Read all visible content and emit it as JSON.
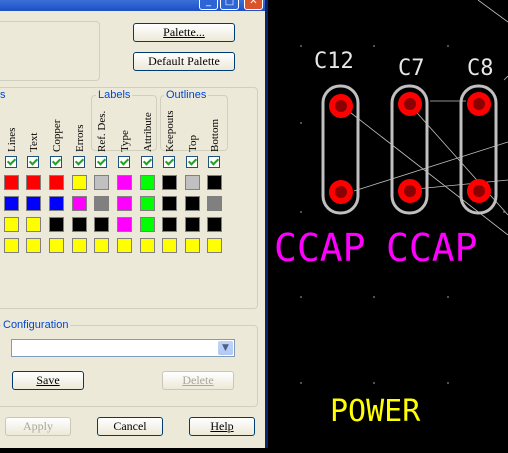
{
  "title_buttons": {
    "minimize": "_",
    "maximize": "□",
    "close": "✕"
  },
  "buttons": {
    "palette": "Palette...",
    "default_palette": "Default Palette",
    "save": "Save",
    "delete": "Delete",
    "apply": "Apply",
    "cancel": "Cancel",
    "help": "Help"
  },
  "groups": {
    "left_partial": "s",
    "labels": "Labels",
    "outlines": "Outlines",
    "configuration": "Configuration"
  },
  "columns": [
    "Lines",
    "Text",
    "Copper",
    "Errors",
    "Ref. Des.",
    "Type",
    "Attribute",
    "Keepouts",
    "Top",
    "Bottom"
  ],
  "configuration_value": "",
  "color_grid": {
    "row_colors": [
      [
        "#ff0000",
        "#ff0000",
        "#ff0000",
        "#ffff00",
        "#c0c0c0",
        "#ff00ff",
        "#00ff00",
        "#000000",
        "#c0c0c0",
        "#000000"
      ],
      [
        "#0000ff",
        "#0000ff",
        "#0000ff",
        "#ff00ff",
        "#808080",
        "#ff00ff",
        "#00ff00",
        "#000000",
        "#000000",
        "#808080"
      ],
      [
        "#ffff00",
        "#ffff00",
        "#000000",
        "#000000",
        "#000000",
        "#ff00ff",
        "#00ff00",
        "#000000",
        "#000000",
        "#000000"
      ],
      [
        "#ffff00",
        "#ffff00",
        "#ffff00",
        "#ffff00",
        "#ffff00",
        "#ffff00",
        "#ffff00",
        "#ffff00",
        "#ffff00",
        "#ffff00"
      ]
    ]
  },
  "pcb": {
    "refdes": [
      "C12",
      "C7",
      "C8"
    ],
    "part_labels": [
      "CCAP",
      "CCAP"
    ],
    "net_label": "POWER",
    "colors": {
      "background": "#000000",
      "outline": "#c0c0c0",
      "pad": "#ff0000",
      "magenta": "#ff00ff",
      "yellow": "#ffff00"
    }
  }
}
